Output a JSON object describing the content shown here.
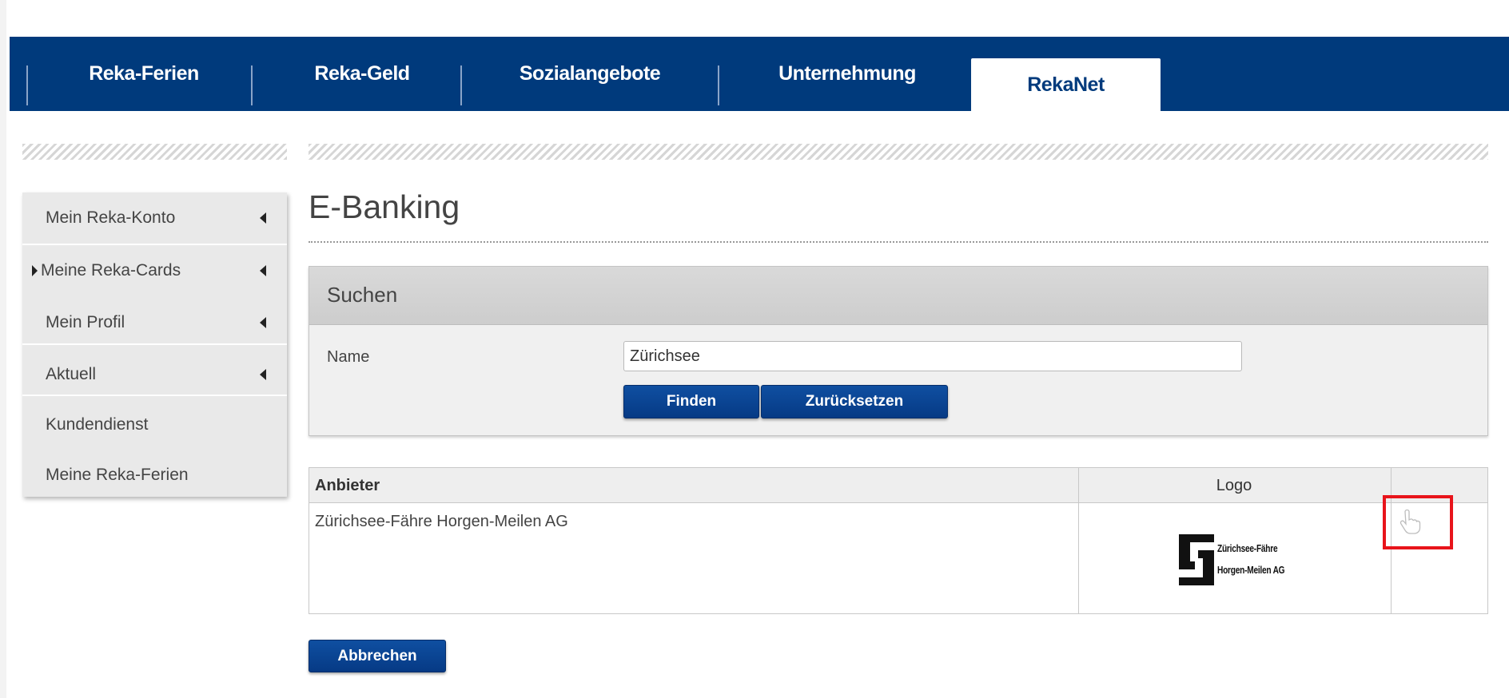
{
  "nav": {
    "items": [
      {
        "label": "Reka-Ferien"
      },
      {
        "label": "Reka-Geld"
      },
      {
        "label": "Sozialangebote"
      },
      {
        "label": "Unternehmung"
      },
      {
        "label": "RekaNet",
        "active": true
      }
    ]
  },
  "sidebar": {
    "items": [
      {
        "label": "Mein Reka-Konto",
        "arrow": "chevron-left-icon"
      },
      {
        "label": "Meine Reka-Cards",
        "arrow": "chevron-left-icon",
        "expand": "chevron-right-icon"
      },
      {
        "label": "Mein Profil",
        "arrow": "chevron-left-icon"
      },
      {
        "label": "Aktuell",
        "arrow": "chevron-left-icon"
      },
      {
        "label": "Kundendienst"
      },
      {
        "label": "Meine Reka-Ferien"
      }
    ]
  },
  "main": {
    "title": "E-Banking",
    "search": {
      "heading": "Suchen",
      "name_label": "Name",
      "name_value": "Zürichsee",
      "find_label": "Finden",
      "reset_label": "Zurücksetzen"
    },
    "results": {
      "columns": [
        "Anbieter",
        "Logo"
      ],
      "rows": [
        {
          "provider": "Zürichsee-Fähre Horgen-Meilen AG",
          "logo_lines": [
            "Zürichsee-Fähre",
            "Horgen-Meilen AG"
          ],
          "action_icon": "hand-pointer-icon"
        }
      ]
    },
    "cancel_label": "Abbrechen"
  },
  "colors": {
    "nav_bg": "#003a7c",
    "button_bg": "#063a85",
    "sidebar_bg": "#e9e9e9",
    "highlight": "#e8141b"
  }
}
